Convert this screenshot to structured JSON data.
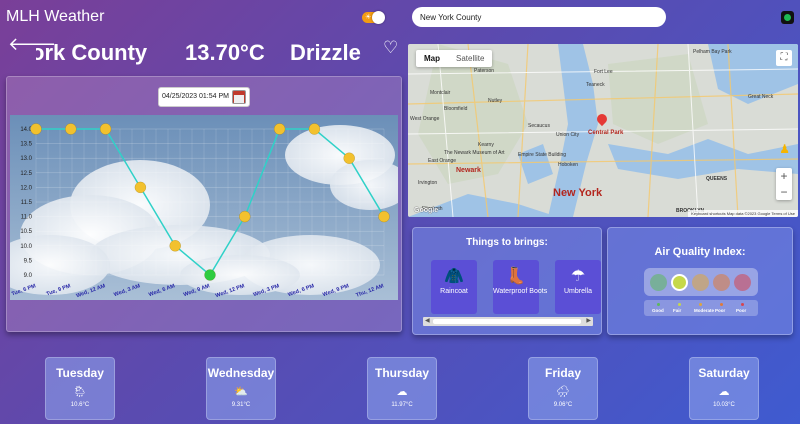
{
  "app": {
    "title": "MLH Weather"
  },
  "search": {
    "value": "New York County"
  },
  "header": {
    "location": "York County",
    "temperature": "13.70°C",
    "condition": "Drizzle"
  },
  "date_picker": {
    "value": "04/25/2023 01:54 PM"
  },
  "chart_data": {
    "type": "line",
    "x": [
      "Tue, 6 PM",
      "Tue, 9 PM",
      "Wed, 12 AM",
      "Wed, 3 AM",
      "Wed, 6 AM",
      "Wed, 9 AM",
      "Wed, 12 PM",
      "Wed, 3 PM",
      "Wed, 6 PM",
      "Wed, 9 PM",
      "Thu, 12 AM"
    ],
    "values": [
      14.0,
      14.0,
      14.0,
      12.0,
      10.0,
      9.0,
      11.0,
      14.0,
      14.0,
      13.0,
      11.0
    ],
    "highlight_index": 5,
    "yticks": [
      "9.0",
      "9.5",
      "10.0",
      "10.5",
      "11.0",
      "11.5",
      "12.0",
      "12.5",
      "13.0",
      "13.5",
      "14.0"
    ],
    "ylim": [
      9,
      14
    ],
    "grid": true,
    "colors": {
      "line": "#2fd1c8",
      "point": "#f2c12e",
      "highlight": "#2ecc40"
    }
  },
  "map": {
    "tabs": [
      {
        "label": "Map",
        "active": true
      },
      {
        "label": "Satellite",
        "active": false
      }
    ],
    "labels": {
      "city": "New York",
      "newark": "Newark",
      "queens": "QUEENS",
      "brooklyn": "BROOKLYN",
      "secaucus": "Secaucus",
      "union_city": "Union City",
      "central_park": "Central Park",
      "montclair": "Montclair",
      "bloomfield": "Bloomfield",
      "paterson": "Paterson",
      "teaneck": "Teaneck",
      "fort_lee": "Fort Lee",
      "empire": "Empire State Building",
      "museum": "The Newark Museum of Art",
      "east_orange": "East Orange",
      "great_neck": "Great Neck",
      "pelham_bay": "Pelham Bay Park",
      "hoboken": "Hoboken",
      "kearny": "Kearny",
      "irvington": "Irvington",
      "elizabeth": "Elizabeth",
      "nutley": "Nutley",
      "west_orange": "West Orange"
    },
    "footer": "Keyboard shortcuts   Map data ©2023 Google   Terms of Use",
    "logo": "Google"
  },
  "things": {
    "title": "Things to brings:",
    "items": [
      {
        "label": "Raincoat",
        "icon": "raincoat-icon"
      },
      {
        "label": "Waterproof Boots",
        "icon": "boots-icon"
      },
      {
        "label": "Umbrella",
        "icon": "umbrella-icon"
      }
    ]
  },
  "aqi": {
    "title": "Air Quality Index:",
    "levels": [
      {
        "label": "Good",
        "color": "#5cb85c"
      },
      {
        "label": "Fair",
        "color": "#c6d84a"
      },
      {
        "label": "Moderate",
        "color": "#e0a63a"
      },
      {
        "label": "Poor",
        "color": "#e07a3a"
      },
      {
        "label": "Poor",
        "color": "#d64550"
      }
    ],
    "selected_index": 1
  },
  "forecast": [
    {
      "day": "Tuesday",
      "temp": "10.6°C",
      "icon": "sun-cloud-rain-icon"
    },
    {
      "day": "Wednesday",
      "temp": "9.31°C",
      "icon": "sun-cloud-icon"
    },
    {
      "day": "Thursday",
      "temp": "11.97°C",
      "icon": "cloud-icon"
    },
    {
      "day": "Friday",
      "temp": "9.06°C",
      "icon": "cloud-rain-icon"
    },
    {
      "day": "Saturday",
      "temp": "10.03°C",
      "icon": "cloud-icon"
    }
  ]
}
